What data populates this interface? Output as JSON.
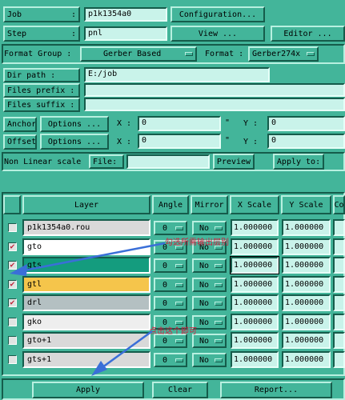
{
  "job": {
    "label": "Job",
    "value": "p1k1354a0",
    "config_button": "Configuration..."
  },
  "step": {
    "label": "Step",
    "value": "pnl",
    "view_button": "View ...",
    "editor_button": "Editor ..."
  },
  "format": {
    "group_label": "Format Group :",
    "group_value": "Gerber Based",
    "format_label": "Format :",
    "format_value": "Gerber274x"
  },
  "paths": {
    "dir_label": "Dir path :",
    "dir_value": "E:/job",
    "prefix_label": "Files prefix :",
    "prefix_value": "",
    "suffix_label": "Files suffix :",
    "suffix_value": ""
  },
  "anchor": {
    "label": "Anchor",
    "options_button": "Options ...",
    "x_label": "X :",
    "x_value": "0",
    "inch_mark": "\"",
    "y_label": "Y :",
    "y_value": "0"
  },
  "offset": {
    "label": "Offset",
    "options_button": "Options ...",
    "x_label": "X :",
    "x_value": "0",
    "inch_mark": "\"",
    "y_label": "Y :",
    "y_value": "0"
  },
  "nonlinear": {
    "label": "Non Linear scale",
    "file_label": "File:",
    "file_value": "",
    "preview_button": "Preview",
    "apply_to_label": "Apply to:"
  },
  "table": {
    "headers": [
      "Layer",
      "Angle",
      "Mirror",
      "X Scale",
      "Y Scale",
      "Co"
    ],
    "rows": [
      {
        "checked": false,
        "name": "p1k1354a0.rou",
        "angle": "0",
        "mirror": "No",
        "xscale": "1.000000",
        "yscale": "1.000000",
        "color": "#d9d9d9"
      },
      {
        "checked": true,
        "name": "gto",
        "angle": "0",
        "mirror": "No",
        "xscale": "1.000000",
        "yscale": "1.000000",
        "color": "#ffffff"
      },
      {
        "checked": true,
        "name": "gts",
        "angle": "0",
        "mirror": "No",
        "xscale": "1.000000",
        "yscale": "1.000000",
        "color": "#149c7e"
      },
      {
        "checked": true,
        "name": "gtl",
        "angle": "0",
        "mirror": "No",
        "xscale": "1.000000",
        "yscale": "1.000000",
        "color": "#f5c54b"
      },
      {
        "checked": true,
        "name": "drl",
        "angle": "0",
        "mirror": "No",
        "xscale": "1.000000",
        "yscale": "1.000000",
        "color": "#b4c0c2"
      },
      {
        "checked": false,
        "name": "gko",
        "angle": "0",
        "mirror": "No",
        "xscale": "1.000000",
        "yscale": "1.000000",
        "color": "#eeeeee"
      },
      {
        "checked": false,
        "name": "gto+1",
        "angle": "0",
        "mirror": "No",
        "xscale": "1.000000",
        "yscale": "1.000000",
        "color": "#d9d9d9"
      },
      {
        "checked": false,
        "name": "gts+1",
        "angle": "0",
        "mirror": "No",
        "xscale": "1.000000",
        "yscale": "1.000000",
        "color": "#d9d9d9"
      }
    ]
  },
  "annotations": {
    "top": "勾选所需输出层别",
    "bottom": "点击这个即可"
  },
  "bottom": {
    "apply_button": "Apply",
    "clear_button": "Clear",
    "report_button": "Report..."
  },
  "colors": {
    "panel": "#43b59a",
    "field": "#c9f3ea",
    "annotation": "#d8183a",
    "arrow": "#3a6fd8"
  }
}
